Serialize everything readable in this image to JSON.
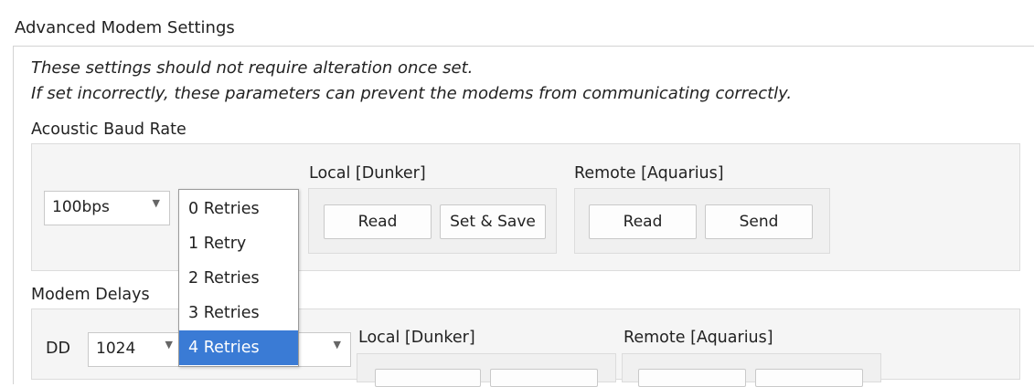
{
  "group_title": "Advanced Modem Settings",
  "notes": {
    "line1": "These settings should not require alteration once set.",
    "line2": "If set incorrectly, these parameters can prevent the modems from communicating correctly."
  },
  "baud": {
    "section_label": "Acoustic Baud Rate",
    "rate_value": "100bps",
    "local_label": "Local [Dunker]",
    "local_read": "Read",
    "local_set_save": "Set & Save",
    "remote_label": "Remote [Aquarius]",
    "remote_read": "Read",
    "remote_send": "Send"
  },
  "retries_dropdown": {
    "options": [
      "0 Retries",
      "1 Retry",
      "2 Retries",
      "3 Retries",
      "4 Retries"
    ],
    "selected": "4 Retries"
  },
  "delays": {
    "section_label": "Modem Delays",
    "dd_label": "DD",
    "dd_value": "1024",
    "local_label": "Local [Dunker]",
    "remote_label": "Remote [Aquarius]"
  },
  "colors": {
    "selection": "#3a7bd5",
    "panel_bg": "#f5f5f5"
  }
}
